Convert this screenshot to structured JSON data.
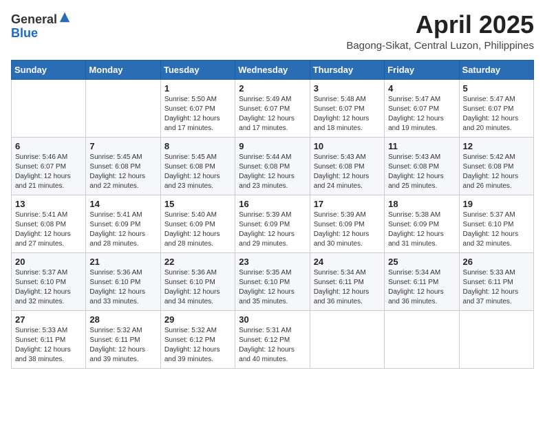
{
  "header": {
    "logo_general": "General",
    "logo_blue": "Blue",
    "title": "April 2025",
    "subtitle": "Bagong-Sikat, Central Luzon, Philippines"
  },
  "weekdays": [
    "Sunday",
    "Monday",
    "Tuesday",
    "Wednesday",
    "Thursday",
    "Friday",
    "Saturday"
  ],
  "weeks": [
    [
      {
        "day": "",
        "info": ""
      },
      {
        "day": "",
        "info": ""
      },
      {
        "day": "1",
        "info": "Sunrise: 5:50 AM\nSunset: 6:07 PM\nDaylight: 12 hours and 17 minutes."
      },
      {
        "day": "2",
        "info": "Sunrise: 5:49 AM\nSunset: 6:07 PM\nDaylight: 12 hours and 17 minutes."
      },
      {
        "day": "3",
        "info": "Sunrise: 5:48 AM\nSunset: 6:07 PM\nDaylight: 12 hours and 18 minutes."
      },
      {
        "day": "4",
        "info": "Sunrise: 5:47 AM\nSunset: 6:07 PM\nDaylight: 12 hours and 19 minutes."
      },
      {
        "day": "5",
        "info": "Sunrise: 5:47 AM\nSunset: 6:07 PM\nDaylight: 12 hours and 20 minutes."
      }
    ],
    [
      {
        "day": "6",
        "info": "Sunrise: 5:46 AM\nSunset: 6:07 PM\nDaylight: 12 hours and 21 minutes."
      },
      {
        "day": "7",
        "info": "Sunrise: 5:45 AM\nSunset: 6:08 PM\nDaylight: 12 hours and 22 minutes."
      },
      {
        "day": "8",
        "info": "Sunrise: 5:45 AM\nSunset: 6:08 PM\nDaylight: 12 hours and 23 minutes."
      },
      {
        "day": "9",
        "info": "Sunrise: 5:44 AM\nSunset: 6:08 PM\nDaylight: 12 hours and 23 minutes."
      },
      {
        "day": "10",
        "info": "Sunrise: 5:43 AM\nSunset: 6:08 PM\nDaylight: 12 hours and 24 minutes."
      },
      {
        "day": "11",
        "info": "Sunrise: 5:43 AM\nSunset: 6:08 PM\nDaylight: 12 hours and 25 minutes."
      },
      {
        "day": "12",
        "info": "Sunrise: 5:42 AM\nSunset: 6:08 PM\nDaylight: 12 hours and 26 minutes."
      }
    ],
    [
      {
        "day": "13",
        "info": "Sunrise: 5:41 AM\nSunset: 6:08 PM\nDaylight: 12 hours and 27 minutes."
      },
      {
        "day": "14",
        "info": "Sunrise: 5:41 AM\nSunset: 6:09 PM\nDaylight: 12 hours and 28 minutes."
      },
      {
        "day": "15",
        "info": "Sunrise: 5:40 AM\nSunset: 6:09 PM\nDaylight: 12 hours and 28 minutes."
      },
      {
        "day": "16",
        "info": "Sunrise: 5:39 AM\nSunset: 6:09 PM\nDaylight: 12 hours and 29 minutes."
      },
      {
        "day": "17",
        "info": "Sunrise: 5:39 AM\nSunset: 6:09 PM\nDaylight: 12 hours and 30 minutes."
      },
      {
        "day": "18",
        "info": "Sunrise: 5:38 AM\nSunset: 6:09 PM\nDaylight: 12 hours and 31 minutes."
      },
      {
        "day": "19",
        "info": "Sunrise: 5:37 AM\nSunset: 6:10 PM\nDaylight: 12 hours and 32 minutes."
      }
    ],
    [
      {
        "day": "20",
        "info": "Sunrise: 5:37 AM\nSunset: 6:10 PM\nDaylight: 12 hours and 32 minutes."
      },
      {
        "day": "21",
        "info": "Sunrise: 5:36 AM\nSunset: 6:10 PM\nDaylight: 12 hours and 33 minutes."
      },
      {
        "day": "22",
        "info": "Sunrise: 5:36 AM\nSunset: 6:10 PM\nDaylight: 12 hours and 34 minutes."
      },
      {
        "day": "23",
        "info": "Sunrise: 5:35 AM\nSunset: 6:10 PM\nDaylight: 12 hours and 35 minutes."
      },
      {
        "day": "24",
        "info": "Sunrise: 5:34 AM\nSunset: 6:11 PM\nDaylight: 12 hours and 36 minutes."
      },
      {
        "day": "25",
        "info": "Sunrise: 5:34 AM\nSunset: 6:11 PM\nDaylight: 12 hours and 36 minutes."
      },
      {
        "day": "26",
        "info": "Sunrise: 5:33 AM\nSunset: 6:11 PM\nDaylight: 12 hours and 37 minutes."
      }
    ],
    [
      {
        "day": "27",
        "info": "Sunrise: 5:33 AM\nSunset: 6:11 PM\nDaylight: 12 hours and 38 minutes."
      },
      {
        "day": "28",
        "info": "Sunrise: 5:32 AM\nSunset: 6:11 PM\nDaylight: 12 hours and 39 minutes."
      },
      {
        "day": "29",
        "info": "Sunrise: 5:32 AM\nSunset: 6:12 PM\nDaylight: 12 hours and 39 minutes."
      },
      {
        "day": "30",
        "info": "Sunrise: 5:31 AM\nSunset: 6:12 PM\nDaylight: 12 hours and 40 minutes."
      },
      {
        "day": "",
        "info": ""
      },
      {
        "day": "",
        "info": ""
      },
      {
        "day": "",
        "info": ""
      }
    ]
  ]
}
